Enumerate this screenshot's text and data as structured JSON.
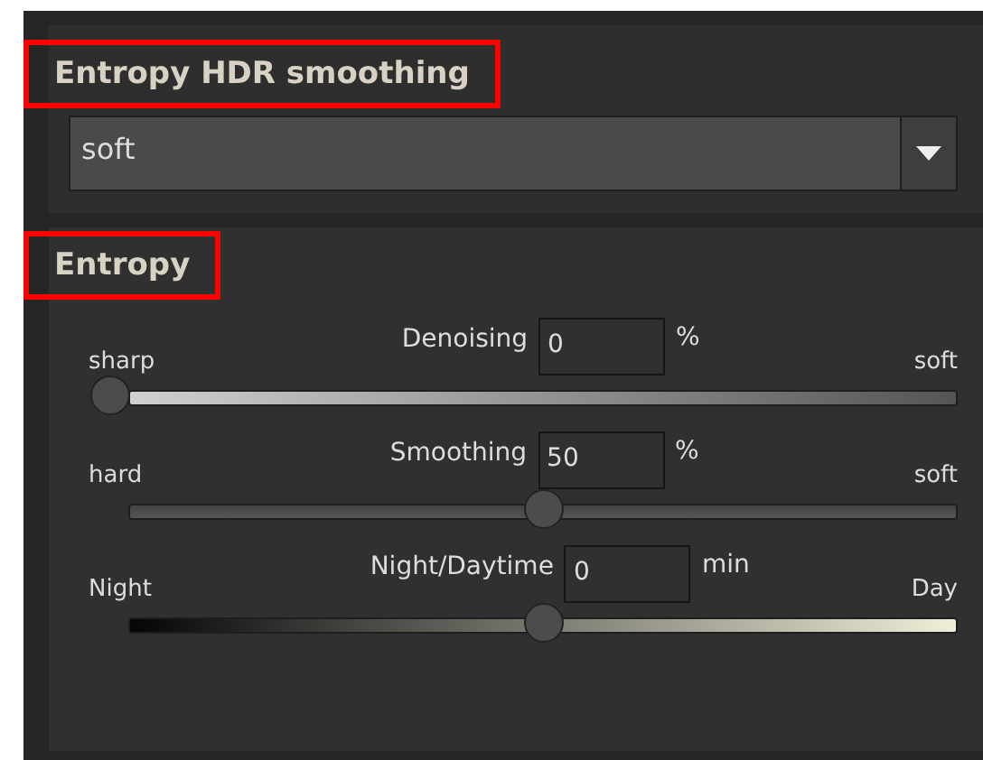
{
  "smoothing_section": {
    "title": "Entropy HDR smoothing",
    "highlighted": true,
    "dropdown": {
      "value": "soft"
    }
  },
  "entropy_section": {
    "title": "Entropy",
    "highlighted": true,
    "sliders": [
      {
        "kind": "fade",
        "left": "sharp",
        "label": "Denoising",
        "value": "0",
        "unit": "%",
        "right": "soft",
        "level": 0
      },
      {
        "kind": "plain",
        "left": "hard",
        "label": "Smoothing",
        "value": "50",
        "unit": "%",
        "right": "soft",
        "level": 0.5
      },
      {
        "kind": "daynight",
        "left": "Night",
        "label": "Night/Daytime",
        "value": "0",
        "unit": "min",
        "right": "Day",
        "level": 0.5
      }
    ]
  }
}
